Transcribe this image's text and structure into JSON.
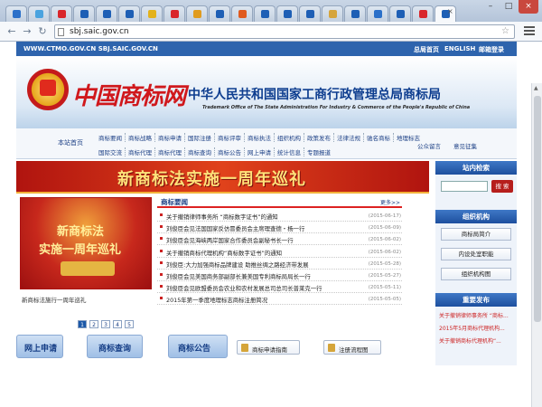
{
  "browser": {
    "url": "sbj.saic.gov.cn",
    "tab_colors": [
      "#2b70c9",
      "#4aa3df",
      "#d9262b",
      "#1e5fb5",
      "#1e5fb5",
      "#1e5fb5",
      "#e3b21b",
      "#d9262b",
      "#e09b1e",
      "#1e5fb5",
      "#e05a1e",
      "#1e5fb5",
      "#1e5fb5",
      "#1e5fb5",
      "#d6a53d",
      "#1e5fb5",
      "#2b70c9",
      "#1e5fb5",
      "#d9262b",
      "#1e5fb5"
    ],
    "close_tab": "×",
    "win_min": "–",
    "win_max": "□",
    "win_close": "×"
  },
  "site": {
    "top_left_urls": "WWW.CTMO.GOV.CN   SBJ.SAIC.GOV.CN",
    "top_right": [
      "总局首页",
      "ENGLISH",
      "邮箱登录"
    ],
    "logo": "中国商标网",
    "title_cn": "中华人民共和国国家工商行政管理总局商标局",
    "title_en": "Trademark Office of The State Administration For Industry & Commerce of the People's Republic of China"
  },
  "nav": {
    "home": "本站首页",
    "row1": [
      "商标要闻",
      "商标战略",
      "商标申请",
      "国际注册",
      "商标评审",
      "商标执法",
      "组织机构",
      "政策发布",
      "法律法规",
      "驰名商标",
      "地理标志"
    ],
    "row2": [
      "国际交流",
      "商标代理",
      "商标代理",
      "商标查询",
      "商标公告",
      "网上申请",
      "统计信息",
      "专题报道"
    ],
    "right_row2": [
      "公众留言",
      "意见征集"
    ]
  },
  "banner": {
    "text": "新商标法实施一周年巡礼"
  },
  "promo": {
    "line1": "新商标法",
    "line2": "实施一周年巡礼",
    "caption": "新商标法施行一周年巡礼"
  },
  "pager": [
    "1",
    "2",
    "3",
    "4",
    "5"
  ],
  "news": {
    "title": "商标要闻",
    "more": "更多>>",
    "items": [
      {
        "title": "关于撤销律师事务所 “商标数字证书”的通知",
        "date": "(2015-06-17)"
      },
      {
        "title": "刘俊臣会见法国国家反仿冒委员会主席理查德・杨一行",
        "date": "(2015-06-09)"
      },
      {
        "title": "刘俊臣会见海峡两岸国家合作委员会副秘书长一行",
        "date": "(2015-06-02)"
      },
      {
        "title": "关于撤销商标代理机构“商标数字证书”的通知",
        "date": "(2015-06-02)"
      },
      {
        "title": "刘俊臣:大力加强商标品牌建设  助推丝绸之路经济带发展",
        "date": "(2015-05-28)"
      },
      {
        "title": "刘俊臣会见美国商务部副部长兼美国专利商标局局长一行",
        "date": "(2015-05-27)"
      },
      {
        "title": "刘俊臣会见欧盟委员会农业和农村发展总司总司长普莱克一行",
        "date": "(2015-05-11)"
      },
      {
        "title": "2015年第一季度地理标志商标注册简况",
        "date": "(2015-05-05)"
      }
    ]
  },
  "right": {
    "search_head": "站内检索",
    "search_btn": "搜 索",
    "org_head": "组织机构",
    "org_items": [
      "商标局简介",
      "内设处室职能",
      "组织机构图"
    ],
    "notice_head": "重要发布",
    "notices": [
      "关于撤销律师事务所 “商标...",
      "2015年5月商标代理机构...",
      "关于撤销商标代理机构“..."
    ]
  },
  "quick": [
    "网上申请",
    "商标查询",
    "商标公告"
  ],
  "services": [
    "商标申请指南",
    "注册流程图"
  ]
}
